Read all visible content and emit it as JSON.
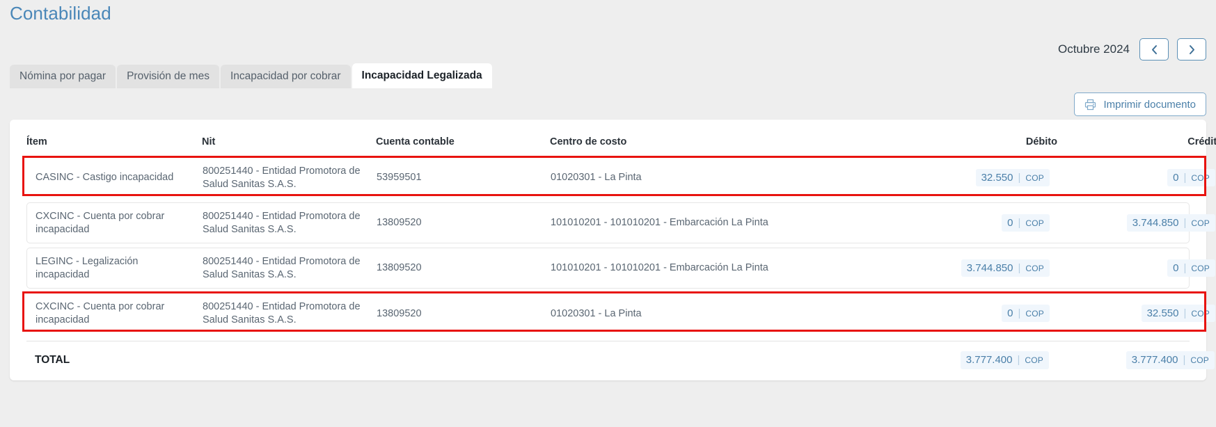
{
  "page": {
    "title": "Contabilidad"
  },
  "month_nav": {
    "label": "Octubre 2024",
    "prev_icon": "chevron-left-icon",
    "next_icon": "chevron-right-icon"
  },
  "tabs": [
    {
      "label": "Nómina por pagar",
      "active": false
    },
    {
      "label": "Provisión de mes",
      "active": false
    },
    {
      "label": "Incapacidad por cobrar",
      "active": false
    },
    {
      "label": "Incapacidad Legalizada",
      "active": true
    }
  ],
  "toolbar": {
    "print_label": "Imprimir documento",
    "print_icon": "printer-icon"
  },
  "table": {
    "headers": [
      "Ítem",
      "Nit",
      "Cuenta contable",
      "Centro de costo",
      "Débito",
      "Crédito"
    ],
    "rows": [
      {
        "item": "CASINC - Castigo incapacidad",
        "nit": "800251440 - Entidad Promotora de Salud Sanitas S.A.S.",
        "cuenta": "53959501",
        "centro": "01020301 - La Pinta",
        "debito": "32.550",
        "debito_currency": "COP",
        "credito": "0",
        "credito_currency": "COP",
        "highlighted": true
      },
      {
        "item": "CXCINC - Cuenta por cobrar incapacidad",
        "nit": "800251440 - Entidad Promotora de Salud Sanitas S.A.S.",
        "cuenta": "13809520",
        "centro": "101010201 - 101010201 - Embarcación La Pinta",
        "debito": "0",
        "debito_currency": "COP",
        "credito": "3.744.850",
        "credito_currency": "COP",
        "highlighted": false
      },
      {
        "item": "LEGINC - Legalización incapacidad",
        "nit": "800251440 - Entidad Promotora de Salud Sanitas S.A.S.",
        "cuenta": "13809520",
        "centro": "101010201 - 101010201 - Embarcación La Pinta",
        "debito": "3.744.850",
        "debito_currency": "COP",
        "credito": "0",
        "credito_currency": "COP",
        "highlighted": false
      },
      {
        "item": "CXCINC - Cuenta por cobrar incapacidad",
        "nit": "800251440 - Entidad Promotora de Salud Sanitas S.A.S.",
        "cuenta": "13809520",
        "centro": "01020301 - La Pinta",
        "debito": "0",
        "debito_currency": "COP",
        "credito": "32.550",
        "credito_currency": "COP",
        "highlighted": true
      }
    ],
    "total": {
      "label": "TOTAL",
      "debito": "3.777.400",
      "debito_currency": "COP",
      "credito": "3.777.400",
      "credito_currency": "COP"
    }
  },
  "colors": {
    "title": "#4a87b8",
    "accent": "#4a7fa8",
    "highlight_border": "#e8130f",
    "amount_bg": "#f0f6fc"
  }
}
